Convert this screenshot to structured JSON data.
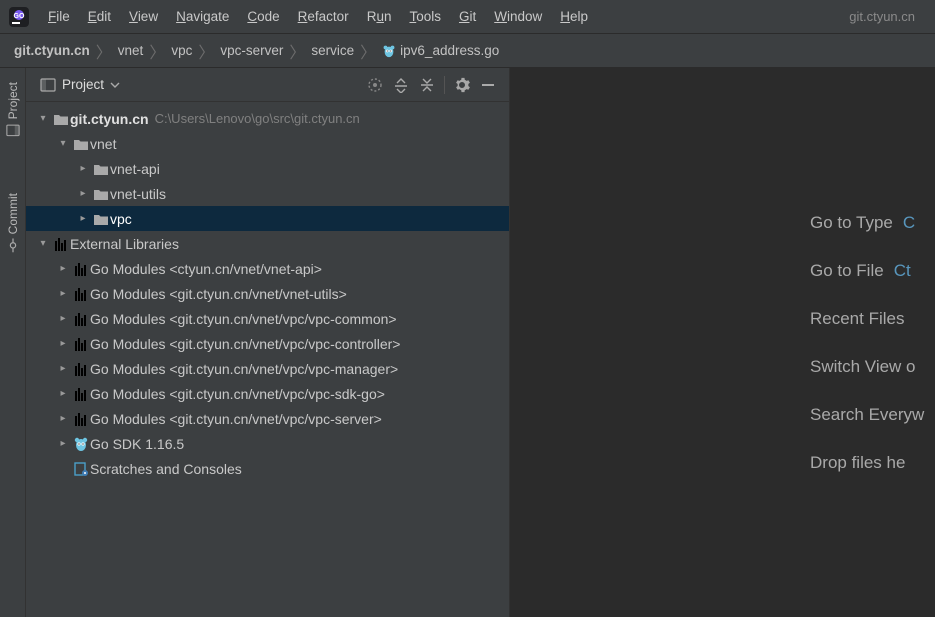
{
  "menu": {
    "items": [
      "File",
      "Edit",
      "View",
      "Navigate",
      "Code",
      "Refactor",
      "Run",
      "Tools",
      "Git",
      "Window",
      "Help"
    ],
    "title": "git.ctyun.cn"
  },
  "breadcrumbs": {
    "root": "git.ctyun.cn",
    "parts": [
      "vnet",
      "vpc",
      "vpc-server",
      "service"
    ],
    "file": "ipv6_address.go"
  },
  "panel": {
    "title": "Project",
    "project_name": "git.ctyun.cn",
    "project_path": "C:\\Users\\Lenovo\\go\\src\\git.ctyun.cn",
    "vnet": "vnet",
    "vnet_api": "vnet-api",
    "vnet_utils": "vnet-utils",
    "vpc": "vpc",
    "ext_lib": "External Libraries",
    "mods": [
      "Go Modules <ctyun.cn/vnet/vnet-api>",
      "Go Modules <git.ctyun.cn/vnet/vnet-utils>",
      "Go Modules <git.ctyun.cn/vnet/vpc/vpc-common>",
      "Go Modules <git.ctyun.cn/vnet/vpc/vpc-controller>",
      "Go Modules <git.ctyun.cn/vnet/vpc/vpc-manager>",
      "Go Modules <git.ctyun.cn/vnet/vpc/vpc-sdk-go>",
      "Go Modules <git.ctyun.cn/vnet/vpc/vpc-server>"
    ],
    "sdk": "Go SDK 1.16.5",
    "scratches": "Scratches and Consoles"
  },
  "toolstrip": {
    "project": "Project",
    "commit": "Commit"
  },
  "hints": {
    "h1": "Go to Type",
    "h1k": "C",
    "h2": "Go to File",
    "h2k": "Ct",
    "h3": "Recent Files",
    "h4": "Switch View o",
    "h5": "Search Everyw",
    "h6": "Drop files he"
  }
}
